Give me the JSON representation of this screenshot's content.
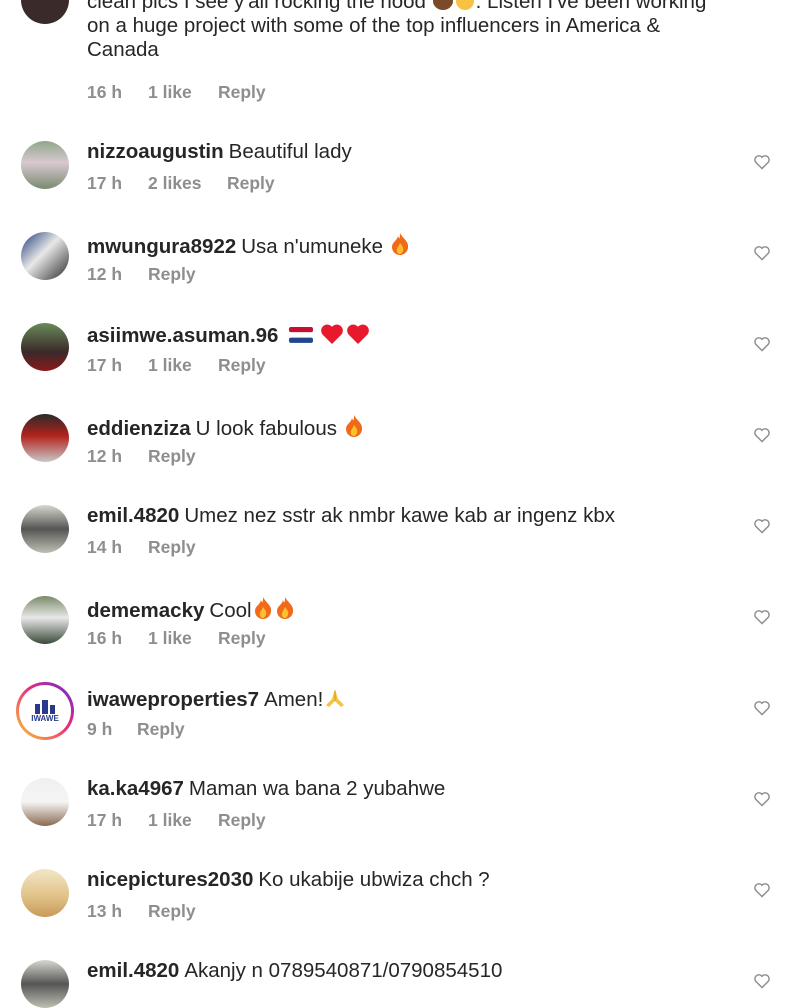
{
  "top_comment": {
    "line1": "clean pics I see y'all rocking the hood",
    "line1b": ". Listen I've been working",
    "line2": "on a huge project with some of the top influencers in America &",
    "line3": "Canada",
    "time": "16 h",
    "likes": "1 like",
    "reply": "Reply"
  },
  "comments": [
    {
      "username": "nizzoaugustin",
      "text": "Beautiful lady",
      "time": "17 h",
      "likes": "2 likes",
      "reply": "Reply"
    },
    {
      "username": "mwungura8922",
      "text": "Usa n'umuneke",
      "time": "12 h",
      "likes": "",
      "reply": "Reply"
    },
    {
      "username": "asiimwe.asuman.96",
      "text": "",
      "time": "17 h",
      "likes": "1 like",
      "reply": "Reply"
    },
    {
      "username": "eddienziza",
      "text": "U look fabulous",
      "time": "12 h",
      "likes": "",
      "reply": "Reply"
    },
    {
      "username": "emil.4820",
      "text": "Umez nez sstr ak nmbr kawe kab ar ingenz kbx",
      "time": "14 h",
      "likes": "",
      "reply": "Reply"
    },
    {
      "username": "dememacky",
      "text": "Cool",
      "time": "16 h",
      "likes": "1 like",
      "reply": "Reply"
    },
    {
      "username": "iwaweproperties7",
      "text": "Amen!",
      "time": "9 h",
      "likes": "",
      "reply": "Reply",
      "avatar_text": "IWAWE"
    },
    {
      "username": "ka.ka4967",
      "text": "Maman wa bana 2 yubahwe",
      "time": "17 h",
      "likes": "1 like",
      "reply": "Reply"
    },
    {
      "username": "nicepictures2030",
      "text": "Ko ukabije ubwiza chch ?",
      "time": "13 h",
      "likes": "",
      "reply": "Reply"
    },
    {
      "username": "emil.4820",
      "text": "Akanjy n 0789540871/0790854510",
      "time": "",
      "likes": "",
      "reply": ""
    }
  ],
  "colors": {
    "text": "#262626",
    "meta": "#8e8e8e",
    "heart": "#8e8e8e"
  }
}
